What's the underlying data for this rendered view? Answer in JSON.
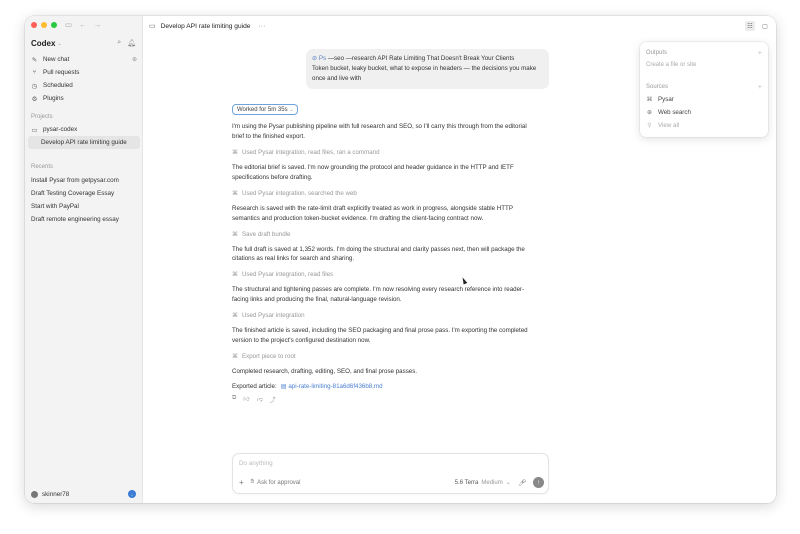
{
  "sidebar": {
    "brand": "Codex",
    "nav": [
      {
        "label": "New chat",
        "icon": "edit-icon"
      },
      {
        "label": "Pull requests",
        "icon": "pull-request-icon"
      },
      {
        "label": "Scheduled",
        "icon": "clock-icon"
      },
      {
        "label": "Plugins",
        "icon": "plugin-icon"
      }
    ],
    "projects_heading": "Projects",
    "project_folder": "pysar-codex",
    "active_thread": "Develop API rate limiting guide",
    "recents_heading": "Recents",
    "recents": [
      "Install Pysar from getpysar.com",
      "Draft Testing Coverage Essay",
      "Start with PayPal",
      "Draft remote engineering essay"
    ],
    "user": "skinner78"
  },
  "topbar": {
    "title": "Develop API rate limiting guide"
  },
  "user_message": {
    "attachment": "Ps",
    "text_1": " —seo —research API Rate Limiting That Doesn't Break Your Clients",
    "text_2": "Token bucket, leaky bucket, what to expose in headers — the decisions you make once and live with"
  },
  "thread": {
    "worked_for": "Worked for 5m 35s",
    "p1": "I'm using the Pysar publishing pipeline with full research and SEO, so I'll carry this through from the editorial brief to the finished export.",
    "t1": "Used Pysar integration, read files, ran a command",
    "p2": "The editorial brief is saved. I'm now grounding the protocol and header guidance in the HTTP and IETF specifications before drafting.",
    "t2": "Used Pysar integration, searched the web",
    "p3": "Research is saved with the rate-limit draft explicitly treated as work in progress, alongside stable HTTP semantics and production token-bucket evidence. I'm drafting the client-facing contract now.",
    "t3": "Save draft bundle",
    "p4": "The full draft is saved at 1,352 words. I'm doing the structural and clarity passes next, then will package the citations as real links for search and sharing.",
    "t4": "Used Pysar integration, read files",
    "p5": "The structural and tightening passes are complete. I'm now resolving every research reference into reader-facing links and producing the final, natural-language revision.",
    "t5": "Used Pysar integration",
    "p6": "The finished article is saved, including the SEO packaging and final prose pass. I'm exporting the completed version to the project's configured destination now.",
    "t6": "Export piece to root",
    "p7": "Completed research, drafting, editing, SEO, and final prose passes.",
    "exported_label": "Exported article:",
    "exported_file": "api-rate-limiting-81a6d6f436b8.md"
  },
  "popover": {
    "outputs_heading": "Outputs",
    "outputs_hint": "Create a file or site",
    "sources_heading": "Sources",
    "sources": [
      {
        "label": "Pysar",
        "icon": "plugin-icon"
      },
      {
        "label": "Web search",
        "icon": "globe-icon"
      },
      {
        "label": "View all",
        "icon": "link-icon"
      }
    ]
  },
  "composer": {
    "placeholder": "Do anything",
    "approval": "Ask for approval",
    "model": "5.6 Terra",
    "effort": "Medium"
  }
}
